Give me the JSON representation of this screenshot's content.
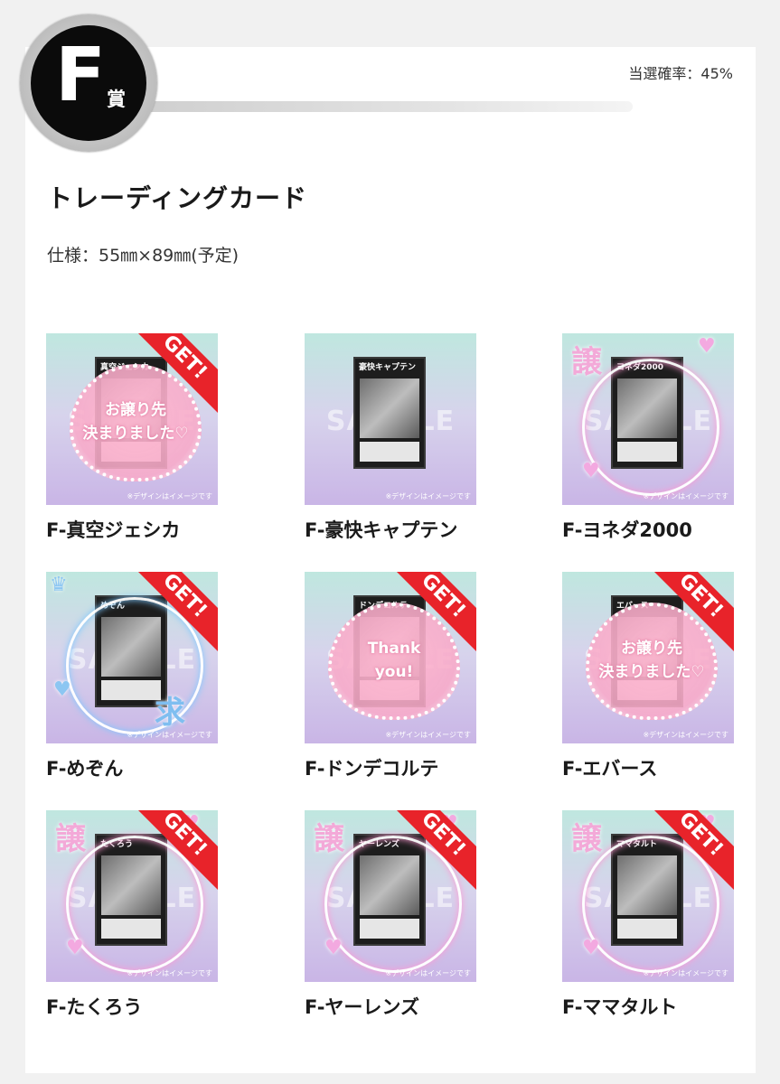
{
  "prize": {
    "letter": "F",
    "suffix": "賞",
    "rate": "当選確率：45%"
  },
  "item": {
    "title": "トレーディングカード",
    "spec": "仕様：55㎜×89㎜(予定)"
  },
  "watermark": "SAMPLE",
  "note": "※デザインはイメージです",
  "get_label": "GET!",
  "cards": [
    {
      "label": "F-真空ジェシカ",
      "card_title": "真空ジェシカ",
      "get": true,
      "overlay": "heart",
      "overlay_text": [
        "お譲り先",
        "決まりました♡"
      ]
    },
    {
      "label": "F-豪快キャプテン",
      "card_title": "豪快キャプテン",
      "get": false,
      "overlay": "none"
    },
    {
      "label": "F-ヨネダ2000",
      "card_title": "ヨネダ2000",
      "get": false,
      "overlay": "neon",
      "overlay_text": [
        "譲"
      ],
      "accent": "#f3a9d8"
    },
    {
      "label": "F-めぞん",
      "card_title": "めぞん",
      "get": true,
      "overlay": "neon-blue",
      "overlay_text": [
        "求"
      ],
      "accent": "#7fbef0"
    },
    {
      "label": "F-ドンデコルテ",
      "card_title": "ドンデコルテ",
      "get": true,
      "overlay": "heart",
      "overlay_text": [
        "Thank",
        "you!"
      ]
    },
    {
      "label": "F-エバース",
      "card_title": "エバース",
      "get": true,
      "overlay": "heart",
      "overlay_text": [
        "お譲り先",
        "決まりました♡"
      ]
    },
    {
      "label": "F-たくろう",
      "card_title": "たくろう",
      "get": true,
      "overlay": "neon",
      "overlay_text": [
        "譲"
      ],
      "accent": "#f3a9d8"
    },
    {
      "label": "F-ヤーレンズ",
      "card_title": "ヤーレンズ",
      "get": true,
      "overlay": "neon",
      "overlay_text": [
        "譲"
      ],
      "accent": "#f3a9d8"
    },
    {
      "label": "F-ママタルト",
      "card_title": "ママタルト",
      "get": true,
      "overlay": "neon",
      "overlay_text": [
        "譲"
      ],
      "accent": "#f3a9d8"
    }
  ]
}
